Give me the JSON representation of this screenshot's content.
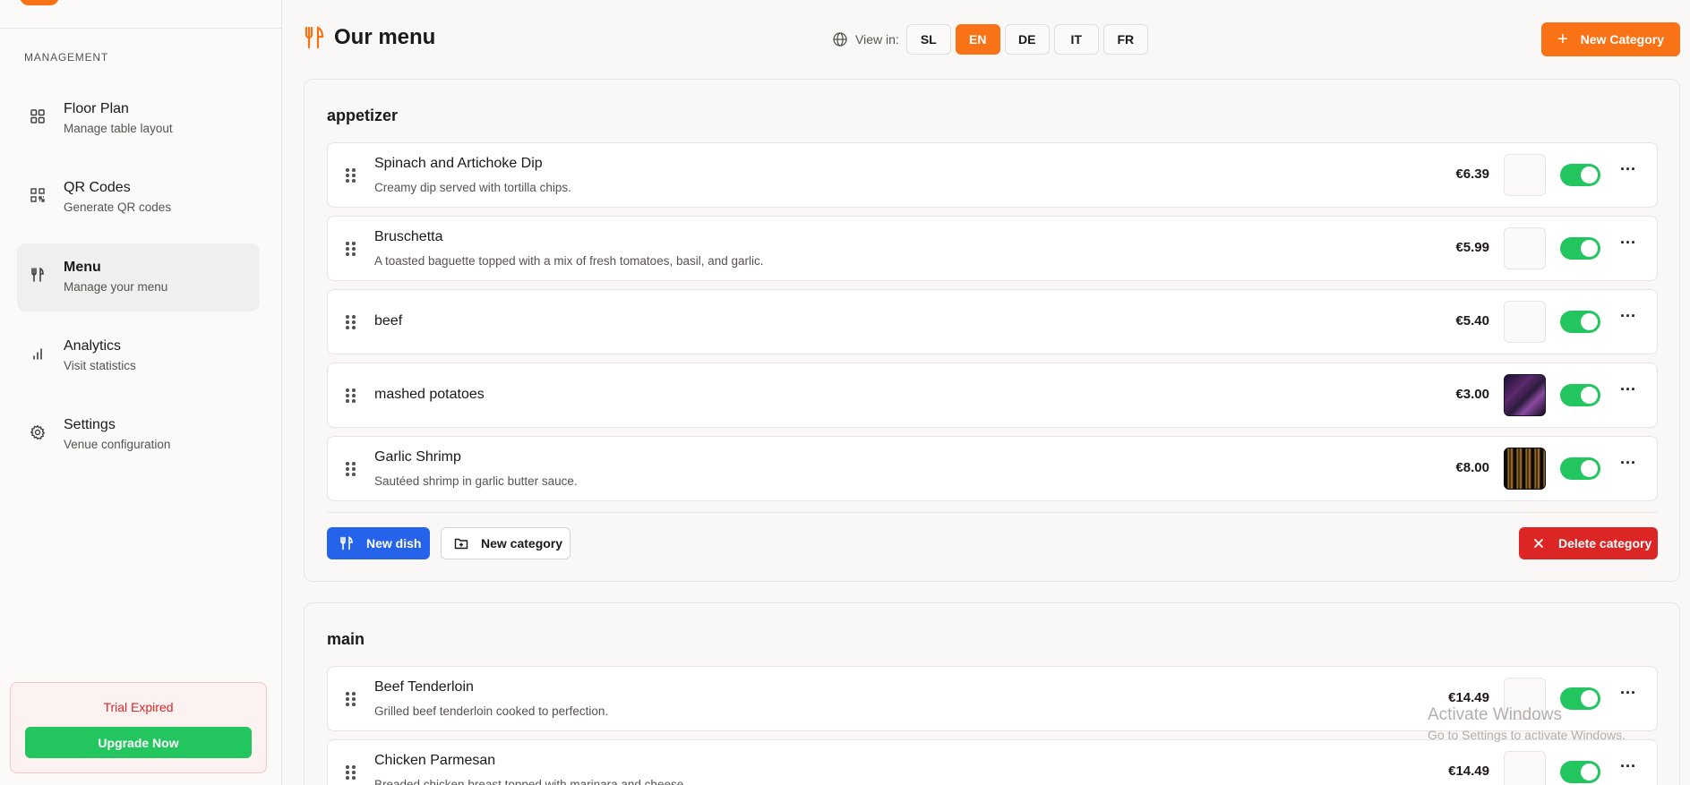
{
  "sidebar": {
    "section_label": "MANAGEMENT",
    "items": [
      {
        "title": "Floor Plan",
        "subtitle": "Manage table layout",
        "icon": "grid-icon"
      },
      {
        "title": "QR Codes",
        "subtitle": "Generate QR codes",
        "icon": "qr-code-icon"
      },
      {
        "title": "Menu",
        "subtitle": "Manage your menu",
        "icon": "utensils-icon",
        "active": true
      },
      {
        "title": "Analytics",
        "subtitle": "Visit statistics",
        "icon": "bar-chart-icon"
      },
      {
        "title": "Settings",
        "subtitle": "Venue configuration",
        "icon": "gear-icon"
      }
    ],
    "trial": {
      "text": "Trial Expired",
      "button": "Upgrade Now"
    }
  },
  "header": {
    "title": "Our menu",
    "view_in_label": "View in:",
    "languages": [
      "SL",
      "EN",
      "DE",
      "IT",
      "FR"
    ],
    "active_language": "EN",
    "new_category_label": "New Category"
  },
  "categories": [
    {
      "name": "appetizer",
      "dishes": [
        {
          "name": "Spinach and Artichoke Dip",
          "description": "Creamy dip served with tortilla chips.",
          "price": "€6.39",
          "image": "empty",
          "enabled": true
        },
        {
          "name": "Bruschetta",
          "description": "A toasted baguette topped with a mix of fresh tomatoes, basil, and garlic.",
          "price": "€5.99",
          "image": "empty",
          "enabled": true
        },
        {
          "name": "beef",
          "description": "",
          "price": "€5.40",
          "image": "empty",
          "enabled": true
        },
        {
          "name": "mashed potatoes",
          "description": "",
          "price": "€3.00",
          "image": "photo",
          "enabled": true
        },
        {
          "name": "Garlic Shrimp",
          "description": "Sautéed shrimp in garlic butter sauce.",
          "price": "€8.00",
          "image": "photo",
          "enabled": true
        }
      ],
      "actions": {
        "new_dish": "New dish",
        "new_category": "New category",
        "delete_category": "Delete category"
      }
    },
    {
      "name": "main",
      "dishes": [
        {
          "name": "Beef Tenderloin",
          "description": "Grilled beef tenderloin cooked to perfection.",
          "price": "€14.49",
          "image": "empty",
          "enabled": true
        },
        {
          "name": "Chicken Parmesan",
          "description": "Breaded chicken breast topped with marinara and cheese.",
          "price": "€14.49",
          "image": "empty",
          "enabled": true
        }
      ]
    }
  ],
  "watermark": {
    "line1": "Activate Windows",
    "line2": "Go to Settings to activate Windows."
  },
  "colors": {
    "accent": "#f97316",
    "toggle_on": "#22c55e",
    "primary_blue": "#2563eb",
    "danger": "#dc2626"
  }
}
